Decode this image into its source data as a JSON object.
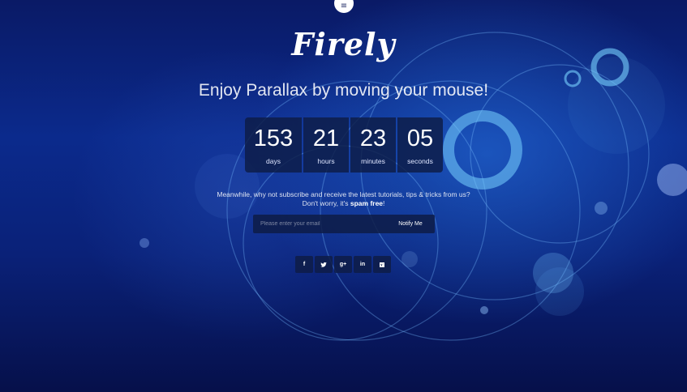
{
  "menu": {
    "icon": "≡"
  },
  "logo": {
    "text": "Firely"
  },
  "tagline": "Enjoy Parallax by moving your mouse!",
  "countdown": [
    {
      "value": "153",
      "label": "days"
    },
    {
      "value": "21",
      "label": "hours"
    },
    {
      "value": "23",
      "label": "minutes"
    },
    {
      "value": "05",
      "label": "seconds"
    }
  ],
  "description": {
    "line1": "Meanwhile, why not subscribe and receive the latest tutorials, tips & tricks from us?",
    "line2_prefix": "Don't worry, it's ",
    "line2_bold": "spam free",
    "line2_suffix": "!"
  },
  "subscribe": {
    "placeholder": "Please enter your email",
    "value": "",
    "button_label": "Notify Me"
  },
  "social": {
    "facebook": "f",
    "twitter": "twitter-icon",
    "google_plus": "g+",
    "linkedin": "in",
    "vimeo": "vimeo-icon"
  },
  "colors": {
    "background_top": "#0a1a66",
    "background_mid": "#0b2a8c",
    "background_bottom": "#06104a",
    "panel": "#0e1c46",
    "text": "#ffffff"
  }
}
